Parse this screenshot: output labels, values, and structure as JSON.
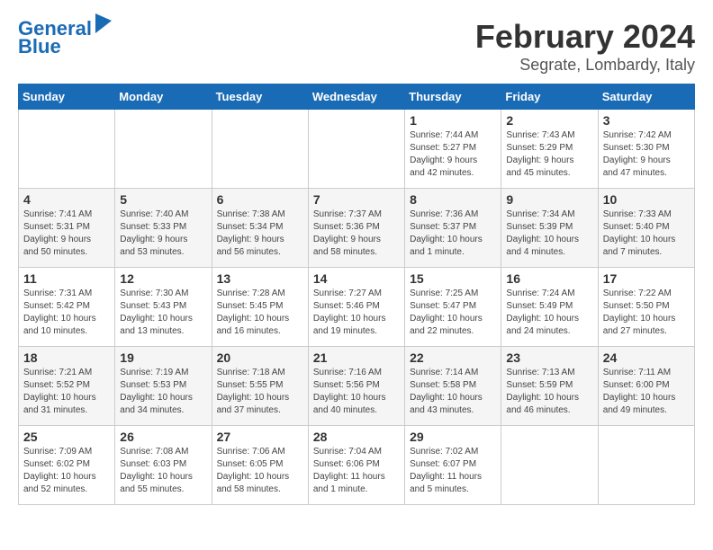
{
  "header": {
    "logo_line1": "General",
    "logo_line2": "Blue",
    "month": "February 2024",
    "location": "Segrate, Lombardy, Italy"
  },
  "weekdays": [
    "Sunday",
    "Monday",
    "Tuesday",
    "Wednesday",
    "Thursday",
    "Friday",
    "Saturday"
  ],
  "weeks": [
    [
      {
        "day": "",
        "info": ""
      },
      {
        "day": "",
        "info": ""
      },
      {
        "day": "",
        "info": ""
      },
      {
        "day": "",
        "info": ""
      },
      {
        "day": "1",
        "info": "Sunrise: 7:44 AM\nSunset: 5:27 PM\nDaylight: 9 hours\nand 42 minutes."
      },
      {
        "day": "2",
        "info": "Sunrise: 7:43 AM\nSunset: 5:29 PM\nDaylight: 9 hours\nand 45 minutes."
      },
      {
        "day": "3",
        "info": "Sunrise: 7:42 AM\nSunset: 5:30 PM\nDaylight: 9 hours\nand 47 minutes."
      }
    ],
    [
      {
        "day": "4",
        "info": "Sunrise: 7:41 AM\nSunset: 5:31 PM\nDaylight: 9 hours\nand 50 minutes."
      },
      {
        "day": "5",
        "info": "Sunrise: 7:40 AM\nSunset: 5:33 PM\nDaylight: 9 hours\nand 53 minutes."
      },
      {
        "day": "6",
        "info": "Sunrise: 7:38 AM\nSunset: 5:34 PM\nDaylight: 9 hours\nand 56 minutes."
      },
      {
        "day": "7",
        "info": "Sunrise: 7:37 AM\nSunset: 5:36 PM\nDaylight: 9 hours\nand 58 minutes."
      },
      {
        "day": "8",
        "info": "Sunrise: 7:36 AM\nSunset: 5:37 PM\nDaylight: 10 hours\nand 1 minute."
      },
      {
        "day": "9",
        "info": "Sunrise: 7:34 AM\nSunset: 5:39 PM\nDaylight: 10 hours\nand 4 minutes."
      },
      {
        "day": "10",
        "info": "Sunrise: 7:33 AM\nSunset: 5:40 PM\nDaylight: 10 hours\nand 7 minutes."
      }
    ],
    [
      {
        "day": "11",
        "info": "Sunrise: 7:31 AM\nSunset: 5:42 PM\nDaylight: 10 hours\nand 10 minutes."
      },
      {
        "day": "12",
        "info": "Sunrise: 7:30 AM\nSunset: 5:43 PM\nDaylight: 10 hours\nand 13 minutes."
      },
      {
        "day": "13",
        "info": "Sunrise: 7:28 AM\nSunset: 5:45 PM\nDaylight: 10 hours\nand 16 minutes."
      },
      {
        "day": "14",
        "info": "Sunrise: 7:27 AM\nSunset: 5:46 PM\nDaylight: 10 hours\nand 19 minutes."
      },
      {
        "day": "15",
        "info": "Sunrise: 7:25 AM\nSunset: 5:47 PM\nDaylight: 10 hours\nand 22 minutes."
      },
      {
        "day": "16",
        "info": "Sunrise: 7:24 AM\nSunset: 5:49 PM\nDaylight: 10 hours\nand 24 minutes."
      },
      {
        "day": "17",
        "info": "Sunrise: 7:22 AM\nSunset: 5:50 PM\nDaylight: 10 hours\nand 27 minutes."
      }
    ],
    [
      {
        "day": "18",
        "info": "Sunrise: 7:21 AM\nSunset: 5:52 PM\nDaylight: 10 hours\nand 31 minutes."
      },
      {
        "day": "19",
        "info": "Sunrise: 7:19 AM\nSunset: 5:53 PM\nDaylight: 10 hours\nand 34 minutes."
      },
      {
        "day": "20",
        "info": "Sunrise: 7:18 AM\nSunset: 5:55 PM\nDaylight: 10 hours\nand 37 minutes."
      },
      {
        "day": "21",
        "info": "Sunrise: 7:16 AM\nSunset: 5:56 PM\nDaylight: 10 hours\nand 40 minutes."
      },
      {
        "day": "22",
        "info": "Sunrise: 7:14 AM\nSunset: 5:58 PM\nDaylight: 10 hours\nand 43 minutes."
      },
      {
        "day": "23",
        "info": "Sunrise: 7:13 AM\nSunset: 5:59 PM\nDaylight: 10 hours\nand 46 minutes."
      },
      {
        "day": "24",
        "info": "Sunrise: 7:11 AM\nSunset: 6:00 PM\nDaylight: 10 hours\nand 49 minutes."
      }
    ],
    [
      {
        "day": "25",
        "info": "Sunrise: 7:09 AM\nSunset: 6:02 PM\nDaylight: 10 hours\nand 52 minutes."
      },
      {
        "day": "26",
        "info": "Sunrise: 7:08 AM\nSunset: 6:03 PM\nDaylight: 10 hours\nand 55 minutes."
      },
      {
        "day": "27",
        "info": "Sunrise: 7:06 AM\nSunset: 6:05 PM\nDaylight: 10 hours\nand 58 minutes."
      },
      {
        "day": "28",
        "info": "Sunrise: 7:04 AM\nSunset: 6:06 PM\nDaylight: 11 hours\nand 1 minute."
      },
      {
        "day": "29",
        "info": "Sunrise: 7:02 AM\nSunset: 6:07 PM\nDaylight: 11 hours\nand 5 minutes."
      },
      {
        "day": "",
        "info": ""
      },
      {
        "day": "",
        "info": ""
      }
    ]
  ]
}
